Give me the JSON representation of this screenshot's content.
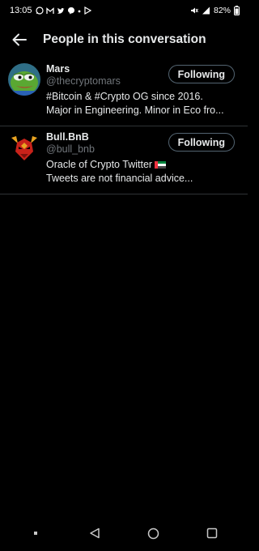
{
  "status_bar": {
    "time": "13:05",
    "battery": "82%",
    "left_icons": [
      "whatsapp-icon",
      "gmail-icon",
      "twitter-icon",
      "messenger-icon",
      "dot-icon",
      "play-icon"
    ],
    "right_icons": [
      "mute-icon",
      "signal-icon",
      "battery-icon"
    ]
  },
  "header": {
    "title": "People in this conversation"
  },
  "users": [
    {
      "name": "Mars",
      "handle": "@thecryptomars",
      "button_label": "Following",
      "bio_line1": "#Bitcoin & #Crypto OG since 2016.",
      "bio_line2": "Major in Engineering. Minor in Eco fro..."
    },
    {
      "name": "Bull.BnB",
      "handle": "@bull_bnb",
      "button_label": "Following",
      "bio_line1": "Oracle of Crypto Twitter",
      "bio_line2": "Tweets are not financial advice..."
    }
  ],
  "nav": [
    "menu-dot",
    "back",
    "home",
    "recents"
  ]
}
